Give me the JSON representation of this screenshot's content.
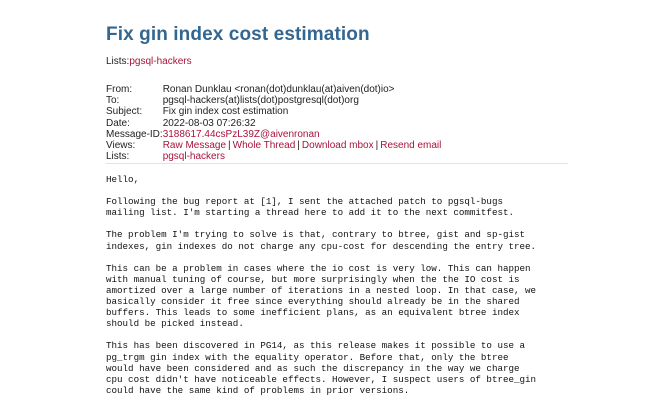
{
  "title": "Fix gin index cost estimation",
  "lists_label": "Lists:",
  "lists_link": "pgsql-hackers",
  "meta": {
    "from_label": "From:",
    "from_value": "Ronan Dunklau <ronan(dot)dunklau(at)aiven(dot)io>",
    "to_label": "To:",
    "to_value": "pgsql-hackers(at)lists(dot)postgresql(dot)org",
    "subject_label": "Subject:",
    "subject_value": "Fix gin index cost estimation",
    "date_label": "Date:",
    "date_value": "2022-08-03 07:26:32",
    "messageid_label": "Message-ID:",
    "messageid_value": "3188617.44csPzL39Z@aivenronan",
    "views_label": "Views:",
    "views": {
      "raw": "Raw Message",
      "thread": "Whole Thread",
      "mbox": "Download mbox",
      "resend": "Resend email",
      "separator": "|"
    },
    "lists_label": "Lists:",
    "lists_value": "pgsql-hackers"
  },
  "message": {
    "paragraphs": [
      [
        "Hello,"
      ],
      [
        "Following the bug report at [1], I sent the attached patch to pgsql-bugs",
        "mailing list. I'm starting a thread here to add it to the next commitfest."
      ],
      [
        "The problem I'm trying to solve is that, contrary to btree, gist and sp-gist",
        "indexes, gin indexes do not charge any cpu-cost for descending the entry tree."
      ],
      [
        "This can be a problem in cases where the io cost is very low. This can happen",
        "with manual tuning of course, but more surprisingly when the the IO cost is",
        "amortized over a large number of iterations in a nested loop. In that case, we",
        "basically consider it free since everything should already be in the shared",
        "buffers. This leads to some inefficient plans, as an equivalent btree index",
        "should be picked instead."
      ],
      [
        "This has been discovered in PG14, as this release makes it possible to use a",
        "pg_trgm gin index with the equality operator. Before that, only the btree",
        "would have been considered and as such the discrepancy in the way we charge",
        "cpu cost didn't have noticeable effects. However, I suspect users of btree_gin",
        "could have the same kind of problems in prior versions."
      ]
    ]
  }
}
